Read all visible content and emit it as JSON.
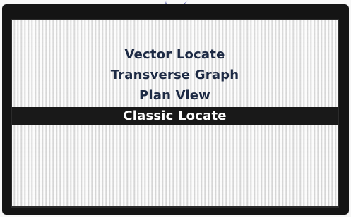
{
  "menu": {
    "items": [
      {
        "label": "Vector Locate",
        "selected": false
      },
      {
        "label": "Transverse Graph",
        "selected": false
      },
      {
        "label": "Plan View",
        "selected": false
      },
      {
        "label": "Classic Locate",
        "selected": true
      }
    ]
  },
  "colors": {
    "frame": "#141414",
    "screen_bg": "#e2e2e2",
    "text": "#1d2a44",
    "selected_bg": "#191919",
    "selected_text": "#ffffff"
  }
}
